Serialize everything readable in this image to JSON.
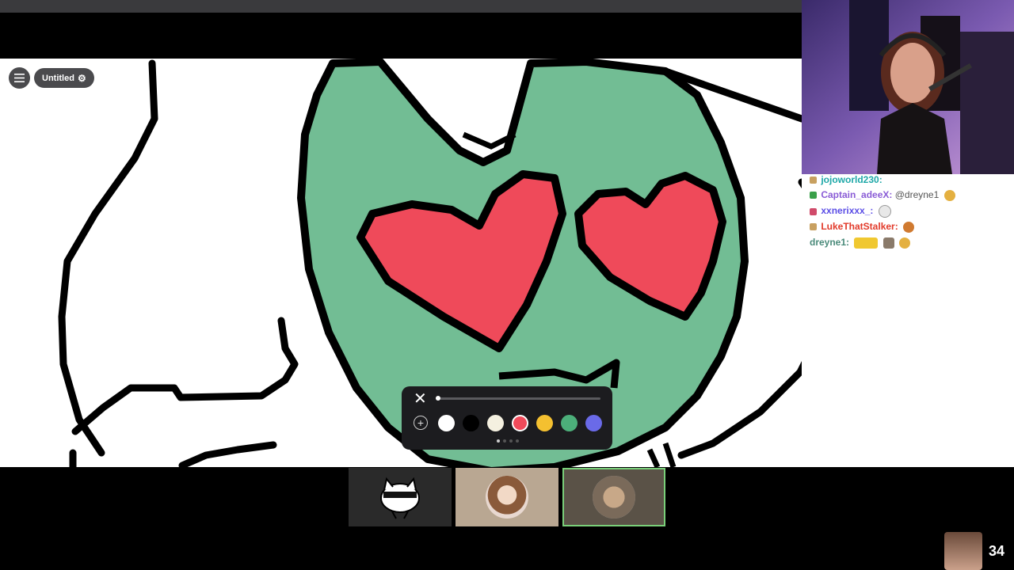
{
  "toolbar": {
    "title": "Untitled"
  },
  "chat": [
    {
      "name": "jojoworld230:",
      "color": "#1fa8a8",
      "message": ""
    },
    {
      "name": "Captain_adeeX:",
      "color": "#8a5cd6",
      "message": "@dreyne1"
    },
    {
      "name": "xxnerixxx_:",
      "color": "#5b4ee6",
      "message": ""
    },
    {
      "name": "LukeThatStalker:",
      "color": "#e23a2a",
      "message": ""
    },
    {
      "name": "dreyne1:",
      "color": "#4a8a7a",
      "message": ""
    }
  ],
  "palette": {
    "colors": [
      {
        "name": "white",
        "hex": "#ffffff"
      },
      {
        "name": "black",
        "hex": "#000000"
      },
      {
        "name": "cream",
        "hex": "#f4f0e0"
      },
      {
        "name": "red",
        "hex": "#f04a5a"
      },
      {
        "name": "yellow",
        "hex": "#f4c030"
      },
      {
        "name": "green",
        "hex": "#4caf7a"
      },
      {
        "name": "blue",
        "hex": "#6a6ae8"
      }
    ],
    "selected": "red"
  },
  "viewer_count": "34",
  "drawing": {
    "face_color": "#72bd94",
    "heart_color": "#ef4a5a",
    "outline_color": "#000000"
  }
}
